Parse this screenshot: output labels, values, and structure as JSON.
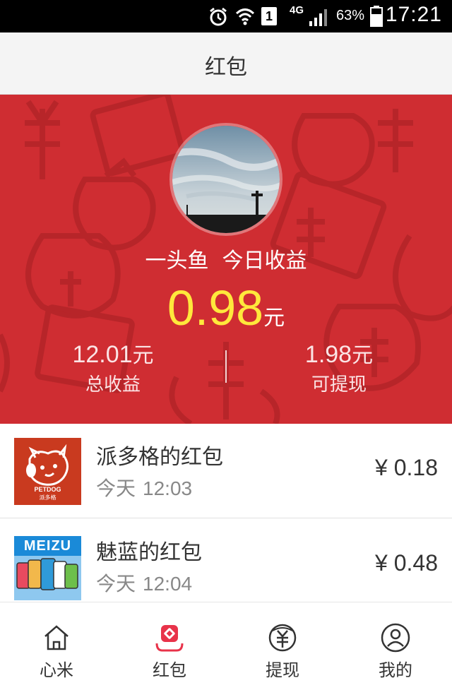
{
  "status_bar": {
    "network": "4G",
    "battery": "63%",
    "time": "17:21",
    "sim_slot": "1"
  },
  "header": {
    "title": "红包"
  },
  "profile": {
    "name": "一头鱼",
    "today_label": "今日收益",
    "today_amount": "0.98",
    "today_unit": "元",
    "total_amount": "12.01",
    "total_unit": "元",
    "total_label": "总收益",
    "withdrawable_amount": "1.98",
    "withdrawable_unit": "元",
    "withdrawable_label": "可提现"
  },
  "list": [
    {
      "title": "派多格的红包",
      "date": "今天",
      "time": "12:03",
      "amount": "¥ 0.18",
      "thumb_text": "PETDOG",
      "thumb_subtext": "派多格"
    },
    {
      "title": "魅蓝的红包",
      "date": "今天",
      "time": "12:04",
      "amount": "¥ 0.48",
      "thumb_text": "MEIZU"
    }
  ],
  "nav": [
    {
      "label": "心米",
      "icon": "home-icon"
    },
    {
      "label": "红包",
      "icon": "red-packet-icon",
      "active": true
    },
    {
      "label": "提现",
      "icon": "withdraw-icon"
    },
    {
      "label": "我的",
      "icon": "profile-icon"
    }
  ],
  "colors": {
    "hero_red": "#cf2d32",
    "amount_yellow": "#ffe83c",
    "petdog_red": "#c93a1f",
    "nav_accent": "#e8334a"
  }
}
